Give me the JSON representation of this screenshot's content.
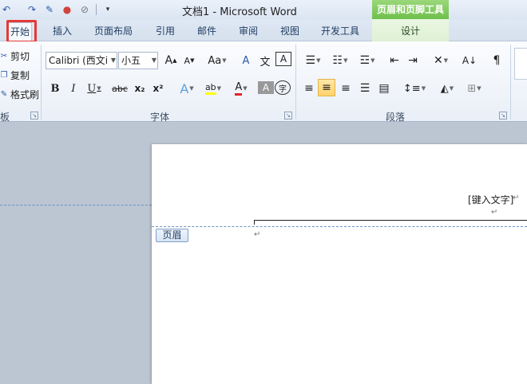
{
  "window": {
    "title": "文档1 - Microsoft Word",
    "context_tab_title": "页眉和页脚工具"
  },
  "tabs": [
    {
      "label": "开始",
      "active": true
    },
    {
      "label": "插入"
    },
    {
      "label": "页面布局"
    },
    {
      "label": "引用"
    },
    {
      "label": "邮件"
    },
    {
      "label": "审阅"
    },
    {
      "label": "视图"
    },
    {
      "label": "开发工具"
    },
    {
      "label": "设计",
      "contextual": true
    }
  ],
  "clipboard": {
    "cut_label": "剪切",
    "copy_label": "复制",
    "format_painter_label": "格式刷",
    "group_label": "板"
  },
  "font": {
    "font_name": "Calibri (西文i",
    "font_size": "小五",
    "group_label": "字体",
    "buttons": {
      "grow": "A",
      "shrink": "A",
      "change_case": "Aa",
      "clear_format": "A",
      "phonetic": "文",
      "char_border": "A",
      "bold": "B",
      "italic": "I",
      "underline": "U",
      "strike": "abc",
      "subscript": "x₂",
      "superscript": "x²",
      "text_effect": "A",
      "highlight": "ab",
      "font_color": "A",
      "char_shading": "A",
      "enclose": "字"
    }
  },
  "paragraph": {
    "group_label": "段落"
  },
  "document": {
    "header_placeholder": "[键入文字]",
    "header_tag": "页眉",
    "paragraph_mark": "↵"
  },
  "colors": {
    "active_highlight": "#e53935",
    "context_tab": "#7dc85a",
    "header_dashed_line": "#6a94c7"
  }
}
